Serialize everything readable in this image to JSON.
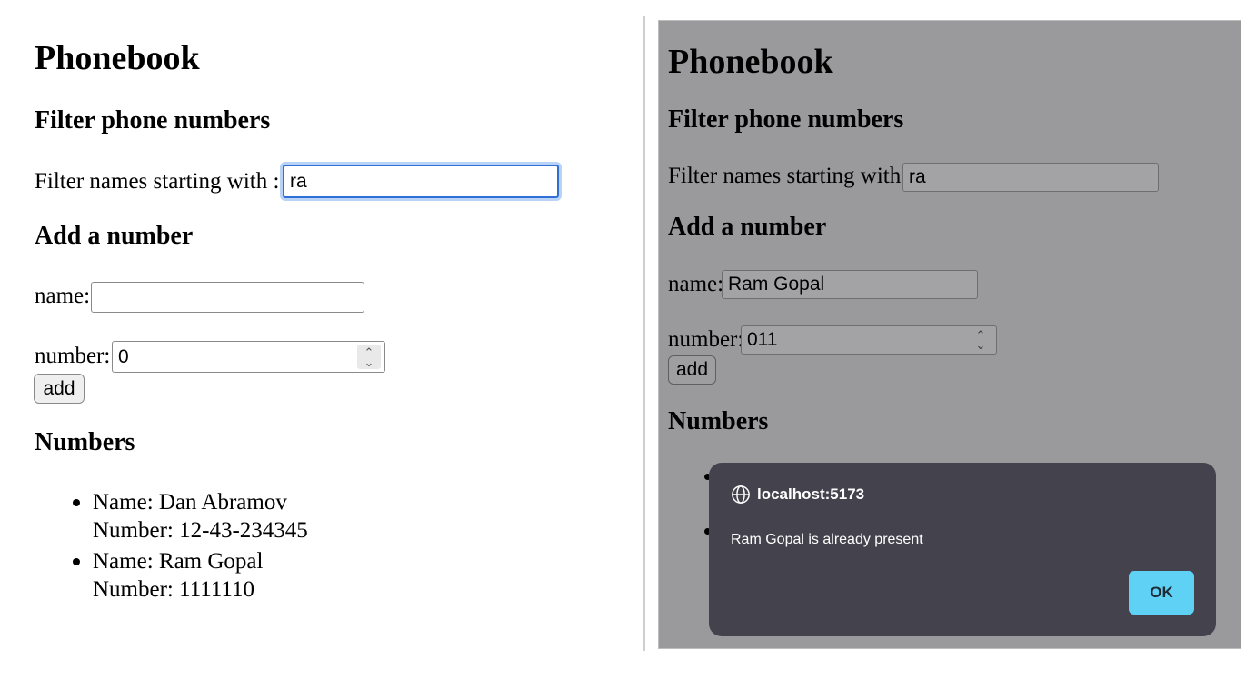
{
  "left": {
    "title": "Phonebook",
    "filter_heading": "Filter phone numbers",
    "filter_label": "Filter names starting with :",
    "filter_value": "ra",
    "add_heading": "Add a number",
    "name_label": "name:",
    "name_value": "",
    "number_label": "number:",
    "number_value": "0",
    "add_button": "add",
    "numbers_heading": "Numbers",
    "entries": [
      {
        "name": "Name: Dan Abramov",
        "number": "Number: 12-43-234345"
      },
      {
        "name": "Name: Ram Gopal",
        "number": "Number: 1111110"
      }
    ]
  },
  "right": {
    "title": "Phonebook",
    "filter_heading": "Filter phone numbers",
    "filter_label": "Filter names starting with :",
    "filter_value": "ra",
    "add_heading": "Add a number",
    "name_label": "name:",
    "name_value": "Ram Gopal",
    "number_label": "number:",
    "number_value": "011",
    "add_button": "add",
    "numbers_heading": "Numbers"
  },
  "dialog": {
    "origin": "localhost:5173",
    "message": "Ram Gopal is already present",
    "ok_label": "OK"
  },
  "colors": {
    "focus_ring": "#2f6fd6",
    "overlay": "#9a999c",
    "dialog_bg": "#44424c",
    "ok_button": "#5fd1f4"
  }
}
